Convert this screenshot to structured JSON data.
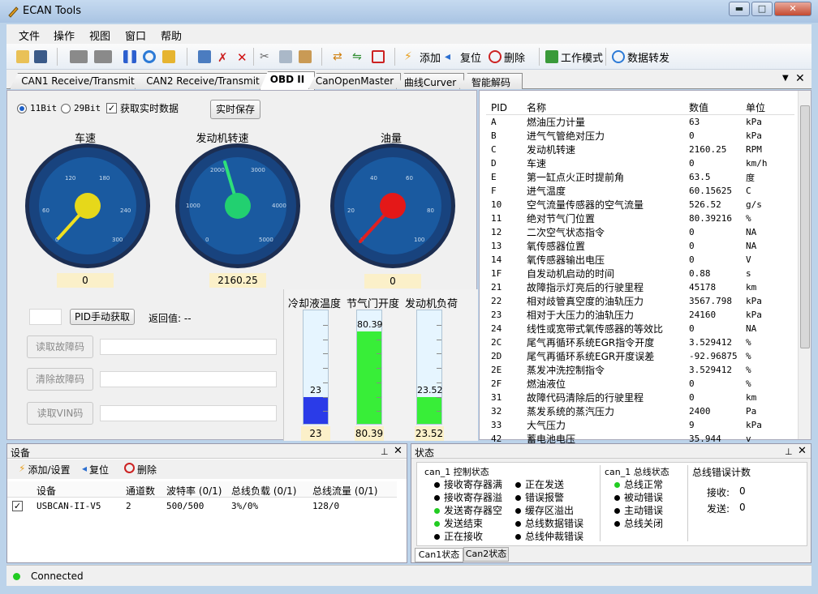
{
  "window": {
    "title": "ECAN Tools",
    "min": "▬",
    "max": "□",
    "close": "✕"
  },
  "menu": [
    "文件",
    "操作",
    "视图",
    "窗口",
    "帮助"
  ],
  "toolbar": {
    "add": "添加",
    "reset": "复位",
    "delete": "删除",
    "work_mode": "工作模式",
    "data_forward": "数据转发"
  },
  "tabs": [
    "CAN1 Receive/Transmit",
    "CAN2 Receive/Transmit",
    "OBD II",
    "CanOpenMaster",
    "曲线Curver",
    "智能解码"
  ],
  "obd": {
    "radio_11": "11Bit",
    "radio_29": "29Bit",
    "realtime_label": "获取实时数据",
    "save_button": "实时保存",
    "gauges": [
      {
        "label": "车速",
        "value": "0",
        "ticks": [
          "0",
          "60",
          "120",
          "180",
          "240",
          "300"
        ]
      },
      {
        "label": "发动机转速",
        "value": "2160.25",
        "ticks": [
          "0",
          "1000",
          "2000",
          "3000",
          "4000",
          "5000"
        ]
      },
      {
        "label": "油量",
        "value": "0",
        "ticks": [
          "0",
          "20",
          "40",
          "60",
          "80",
          "100"
        ]
      }
    ],
    "bars": [
      {
        "label": "冷却液温度",
        "value": "23",
        "level": 0.23,
        "color": "#2a3be8"
      },
      {
        "label": "节气门开度",
        "value": "80.39",
        "level": 0.8039,
        "color": "#38ee38"
      },
      {
        "label": "发动机负荷",
        "value": "23.52",
        "level": 0.2352,
        "color": "#38ee38"
      }
    ],
    "pid_button": "PID手动获取",
    "return_label": "返回值: --",
    "read_dtc": "读取故障码",
    "clear_dtc": "清除故障码",
    "read_vin": "读取VIN码"
  },
  "pid_table": {
    "headers": [
      "PID",
      "名称",
      "数值",
      "单位"
    ],
    "rows": [
      [
        "A",
        "燃油压力计量",
        "63",
        "kPa"
      ],
      [
        "B",
        "进气气管绝对压力",
        "0",
        "kPa"
      ],
      [
        "C",
        "发动机转速",
        "2160.25",
        "RPM"
      ],
      [
        "D",
        "车速",
        "0",
        "km/h"
      ],
      [
        "E",
        "第一缸点火正时提前角",
        "63.5",
        "度"
      ],
      [
        "F",
        "进气温度",
        "60.15625",
        "C"
      ],
      [
        "10",
        "空气流量传感器的空气流量",
        "526.52",
        "g/s"
      ],
      [
        "11",
        "绝对节气门位置",
        "80.39216",
        "%"
      ],
      [
        "12",
        "二次空气状态指令",
        "0",
        "NA"
      ],
      [
        "13",
        "氧传感器位置",
        "0",
        "NA"
      ],
      [
        "14",
        "氧传感器输出电压",
        "0",
        "V"
      ],
      [
        "1F",
        "自发动机启动的时间",
        "0.88",
        "s"
      ],
      [
        "21",
        "故障指示灯亮后的行驶里程",
        "45178",
        "km"
      ],
      [
        "22",
        "相对歧管真空度的油轨压力",
        "3567.798",
        "kPa"
      ],
      [
        "23",
        "相对于大压力的油轨压力",
        "24160",
        "kPa"
      ],
      [
        "24",
        "线性或宽带式氧传感器的等效比",
        "0",
        "NA"
      ],
      [
        "2C",
        "尾气再循环系统EGR指令开度",
        "3.529412",
        "%"
      ],
      [
        "2D",
        "尾气再循环系统EGR开度误差",
        "-92.96875",
        "%"
      ],
      [
        "2E",
        "蒸发冲洗控制指令",
        "3.529412",
        "%"
      ],
      [
        "2F",
        "燃油液位",
        "0",
        "%"
      ],
      [
        "31",
        "故障代码清除后的行驶里程",
        "0",
        "km"
      ],
      [
        "32",
        "蒸发系统的蒸汽压力",
        "2400",
        "Pa"
      ],
      [
        "33",
        "大气压力",
        "9",
        "kPa"
      ],
      [
        "42",
        "蓄电池电压",
        "35.944",
        "v"
      ]
    ]
  },
  "device_panel": {
    "title": "设备",
    "add": "添加/设置",
    "reset": "复位",
    "delete": "删除",
    "headers": [
      "设备",
      "通道数",
      "波特率 (0/1)",
      "总线负载 (0/1)",
      "总线流量 (0/1)"
    ],
    "row": [
      "USBCAN-II-V5",
      "2",
      "500/500",
      "3%/0%",
      "128/0"
    ]
  },
  "status_panel": {
    "title": "状态",
    "ctrl_title": "can_1 控制状态",
    "ctrl_col1": [
      {
        "t": "接收寄存器满",
        "c": "#000"
      },
      {
        "t": "接收寄存器溢",
        "c": "#000"
      },
      {
        "t": "发送寄存器空",
        "c": "#22cc22"
      },
      {
        "t": "发送结束",
        "c": "#22cc22"
      },
      {
        "t": "正在接收",
        "c": "#000"
      }
    ],
    "ctrl_col2": [
      {
        "t": "正在发送",
        "c": "#000"
      },
      {
        "t": "错误报警",
        "c": "#000"
      },
      {
        "t": "缓存区溢出",
        "c": "#000"
      },
      {
        "t": "总线数据错误",
        "c": "#000"
      },
      {
        "t": "总线仲裁错误",
        "c": "#000"
      }
    ],
    "bus_title": "can_1 总线状态",
    "bus_items": [
      {
        "t": "总线正常",
        "c": "#22cc22"
      },
      {
        "t": "被动错误",
        "c": "#000"
      },
      {
        "t": "主动错误",
        "c": "#000"
      },
      {
        "t": "总线关闭",
        "c": "#000"
      }
    ],
    "err_title": "总线错误计数",
    "recv_label": "接收:",
    "recv_val": "0",
    "send_label": "发送:",
    "send_val": "0",
    "tab1": "Can1状态",
    "tab2": "Can2状态"
  },
  "statusbar": {
    "text": "Connected"
  }
}
